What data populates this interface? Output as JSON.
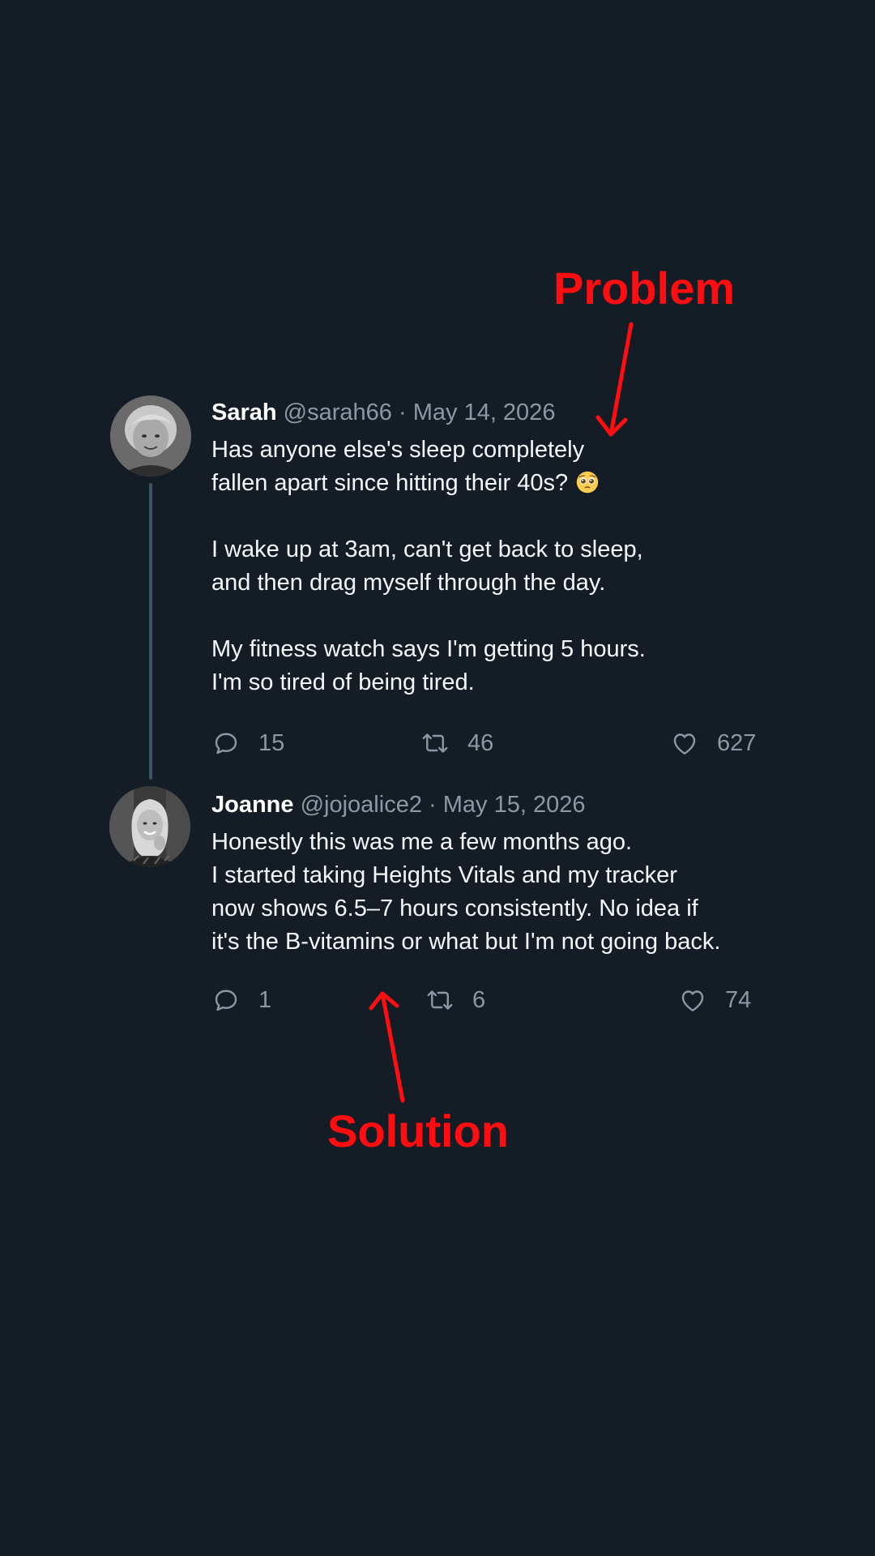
{
  "annotations": {
    "problem": "Problem",
    "solution": "Solution"
  },
  "colors": {
    "background": "#141d26",
    "annotation": "#ff0d10",
    "muted": "#8b98a5",
    "text": "#f5f8fa",
    "thread_line": "#3d5466"
  },
  "tweets": [
    {
      "name": "Sarah",
      "handle": "@sarah66",
      "date": "May 14, 2026",
      "avatar_icon": "woman-avatar-photo",
      "lines": [
        "Has anyone else's sleep completely",
        "fallen apart since hitting their 40s?"
      ],
      "emoji": "pleading-face-emoji",
      "lines2": [
        "I wake up at 3am, can't get back to sleep,",
        "and then drag myself through the day."
      ],
      "lines3": [
        "My fitness watch says I'm getting 5 hours.",
        "I'm so tired of being tired."
      ],
      "replies": "15",
      "retweets": "46",
      "likes": "627"
    },
    {
      "name": "Joanne",
      "handle": "@jojoalice2",
      "date": "May 15, 2026",
      "avatar_icon": "woman-avatar-photo",
      "lines": [
        "Honestly this was me a few months ago.",
        "I started taking Heights Vitals and my tracker",
        "now shows 6.5–7 hours consistently. No idea if",
        "it's the B-vitamins or what but I'm not going back."
      ],
      "replies": "1",
      "retweets": "6",
      "likes": "74"
    }
  ],
  "separator": "·"
}
